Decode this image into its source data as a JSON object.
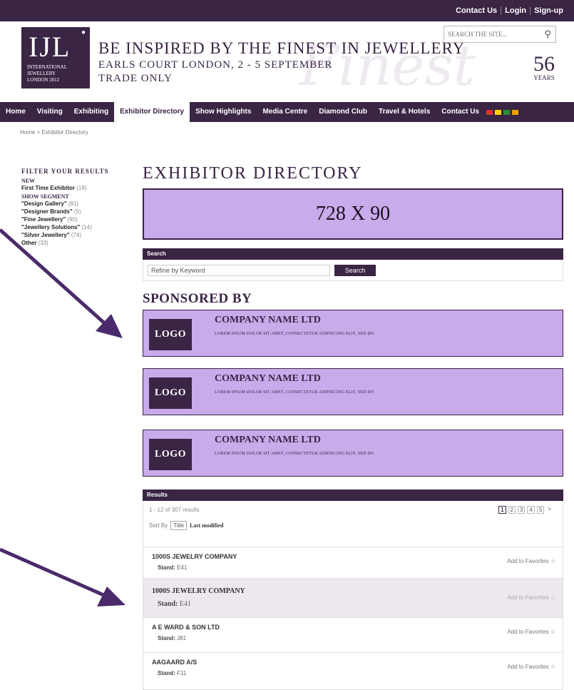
{
  "topbar": {
    "links": [
      "Contact Us",
      "Login",
      "Sign-up"
    ]
  },
  "logo": {
    "mark": "IJL",
    "lines": [
      "INTERNATIONAL",
      "JEWELLERY",
      "LONDON 2012"
    ]
  },
  "tagline": {
    "line1": "BE INSPIRED BY THE FINEST IN JEWELLERY",
    "line2": "EARLS COURT LONDON, 2 - 5 SEPTEMBER",
    "line3": "TRADE ONLY"
  },
  "watermark": "Finest",
  "site_search": {
    "placeholder": "SEARCH THE SITE..."
  },
  "years": {
    "number": "56",
    "word": "YEARS"
  },
  "nav": {
    "items": [
      "Home",
      "Visiting",
      "Exhibiting",
      "Exhibitor Directory",
      "Show Highlights",
      "Media Centre",
      "Diamond Club",
      "Travel & Hotels",
      "Contact Us"
    ],
    "flag_colors": [
      "#e03030",
      "#ffd200",
      "#2a8a3a",
      "#e8a000"
    ]
  },
  "breadcrumb": "Home > Exhibitor Directory",
  "sidebar": {
    "title": "FILTER YOUR RESULTS",
    "new_label": "NEW",
    "first_time": {
      "label": "First Time Exhibitor",
      "count": "(18)"
    },
    "segment_label": "SHOW SEGMENT",
    "segments": [
      {
        "label": "\"Design Gallery\"",
        "count": "(81)"
      },
      {
        "label": "\"Designer Brands\"",
        "count": "(5)"
      },
      {
        "label": "\"Fine Jewellery\"",
        "count": "(90)"
      },
      {
        "label": "\"Jewellery Solutions\"",
        "count": "(14)"
      },
      {
        "label": "\"Silver Jewellery\"",
        "count": "(74)"
      },
      {
        "label": "Other",
        "count": "(33)"
      }
    ]
  },
  "main": {
    "title": "EXHIBITOR DIRECTORY",
    "banner": "728 X 90",
    "search_head": "Search",
    "search_placeholder": "Refine by Keyword",
    "search_button": "Search",
    "sponsored_title": "SPONSORED BY",
    "sponsors": [
      {
        "logo": "LOGO",
        "name": "COMPANY NAME LTD",
        "desc": "LOREM IPSUM DOLOR SIT AMET, CONSECTETUR ADIPISCING ELIT, SED DO"
      },
      {
        "logo": "LOGO",
        "name": "COMPANY NAME LTD",
        "desc": "LOREM IPSUM DOLOR SIT AMET, CONSECTETUR ADIPISCING ELIT, SED DO"
      },
      {
        "logo": "LOGO",
        "name": "COMPANY NAME LTD",
        "desc": "LOREM IPSUM DOLOR SIT AMET, CONSECTETUR ADIPISCING ELIT, SED DO"
      }
    ],
    "results_head": "Results",
    "results_count": "1 - 12 of 307 results",
    "sort_label": "Sort By",
    "sort_options": [
      "Title",
      "Last modified"
    ],
    "pages": [
      "1",
      "2",
      "3",
      "4",
      "5",
      ">"
    ],
    "rows": [
      {
        "name": "1000S JEWELRY COMPANY",
        "stand_label": "Stand:",
        "stand": "E41",
        "fav": "Add to Favorites"
      },
      {
        "name": "1000S JEWELRY COMPANY",
        "stand_label": "Stand:",
        "stand": "E41",
        "fav": "Add to Favorites"
      },
      {
        "name": "A E WARD & SON LTD",
        "stand_label": "Stand:",
        "stand": "J81",
        "fav": "Add to Favorites"
      },
      {
        "name": "AAGAARD A/S",
        "stand_label": "Stand:",
        "stand": "F11",
        "fav": "Add to Favorites"
      }
    ]
  },
  "accent": "#3a2545",
  "highlight": "#c9aaea"
}
